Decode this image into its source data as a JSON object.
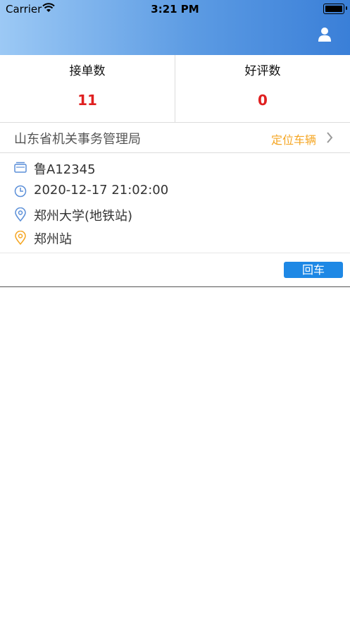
{
  "status_bar": {
    "carrier": "Carrier",
    "time": "3:21 PM"
  },
  "header": {
    "user_icon": "user-icon"
  },
  "stats": [
    {
      "label": "接单数",
      "value": "11"
    },
    {
      "label": "好评数",
      "value": "0"
    }
  ],
  "order": {
    "organization": "山东省机关事务管理局",
    "locate_label": "定位车辆",
    "plate": "鲁A12345",
    "datetime": "2020-12-17 21:02:00",
    "from": "郑州大学(地铁站)",
    "to": "郑州站",
    "return_label": "回车"
  },
  "colors": {
    "accent": "#1e88e5",
    "value_red": "#e02020",
    "locate_orange": "#f5a623"
  }
}
